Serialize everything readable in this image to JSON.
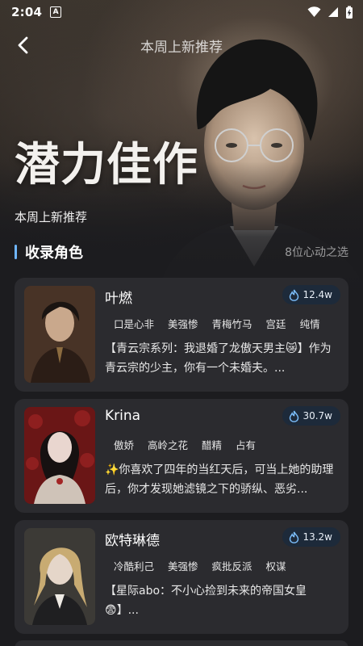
{
  "status": {
    "time": "2:04",
    "a_badge": "A",
    "icons": [
      "wifi-icon",
      "signal-icon",
      "battery-charging-icon"
    ]
  },
  "nav": {
    "title": "本周上新推荐",
    "back_icon": "chevron-left-icon"
  },
  "hero": {
    "title": "潜力佳作",
    "subtitle": "本周上新推荐"
  },
  "section": {
    "title": "收录角色",
    "meta": "8位心动之选",
    "accent": "#6fb6ff"
  },
  "cards": [
    {
      "name": "叶燃",
      "heat": "12.4w",
      "tags": [
        "口是心非",
        "美强惨",
        "青梅竹马",
        "宫廷",
        "纯情"
      ],
      "desc": "【青云宗系列：我退婚了龙傲天男主😿】作为青云宗的少主，你有一个未婚夫。..."
    },
    {
      "name": "Krina",
      "heat": "30.7w",
      "tags": [
        "傲娇",
        "高岭之花",
        "醋精",
        "占有"
      ],
      "desc": "✨你喜欢了四年的当红天后，可当上她的助理后，你才发现她滤镜之下的骄纵、恶劣..."
    },
    {
      "name": "欧特琳德",
      "heat": "13.2w",
      "tags": [
        "冷酷利己",
        "美强惨",
        "疯批反派",
        "权谋"
      ],
      "desc": "【星际abo：不小心捡到未来的帝国女皇😨】..."
    }
  ],
  "colors": {
    "background": "#1c1c1f",
    "card": "#2b2b2f",
    "heat_badge": "#1d2a3a",
    "heat_icon": "#7ec1ff"
  }
}
